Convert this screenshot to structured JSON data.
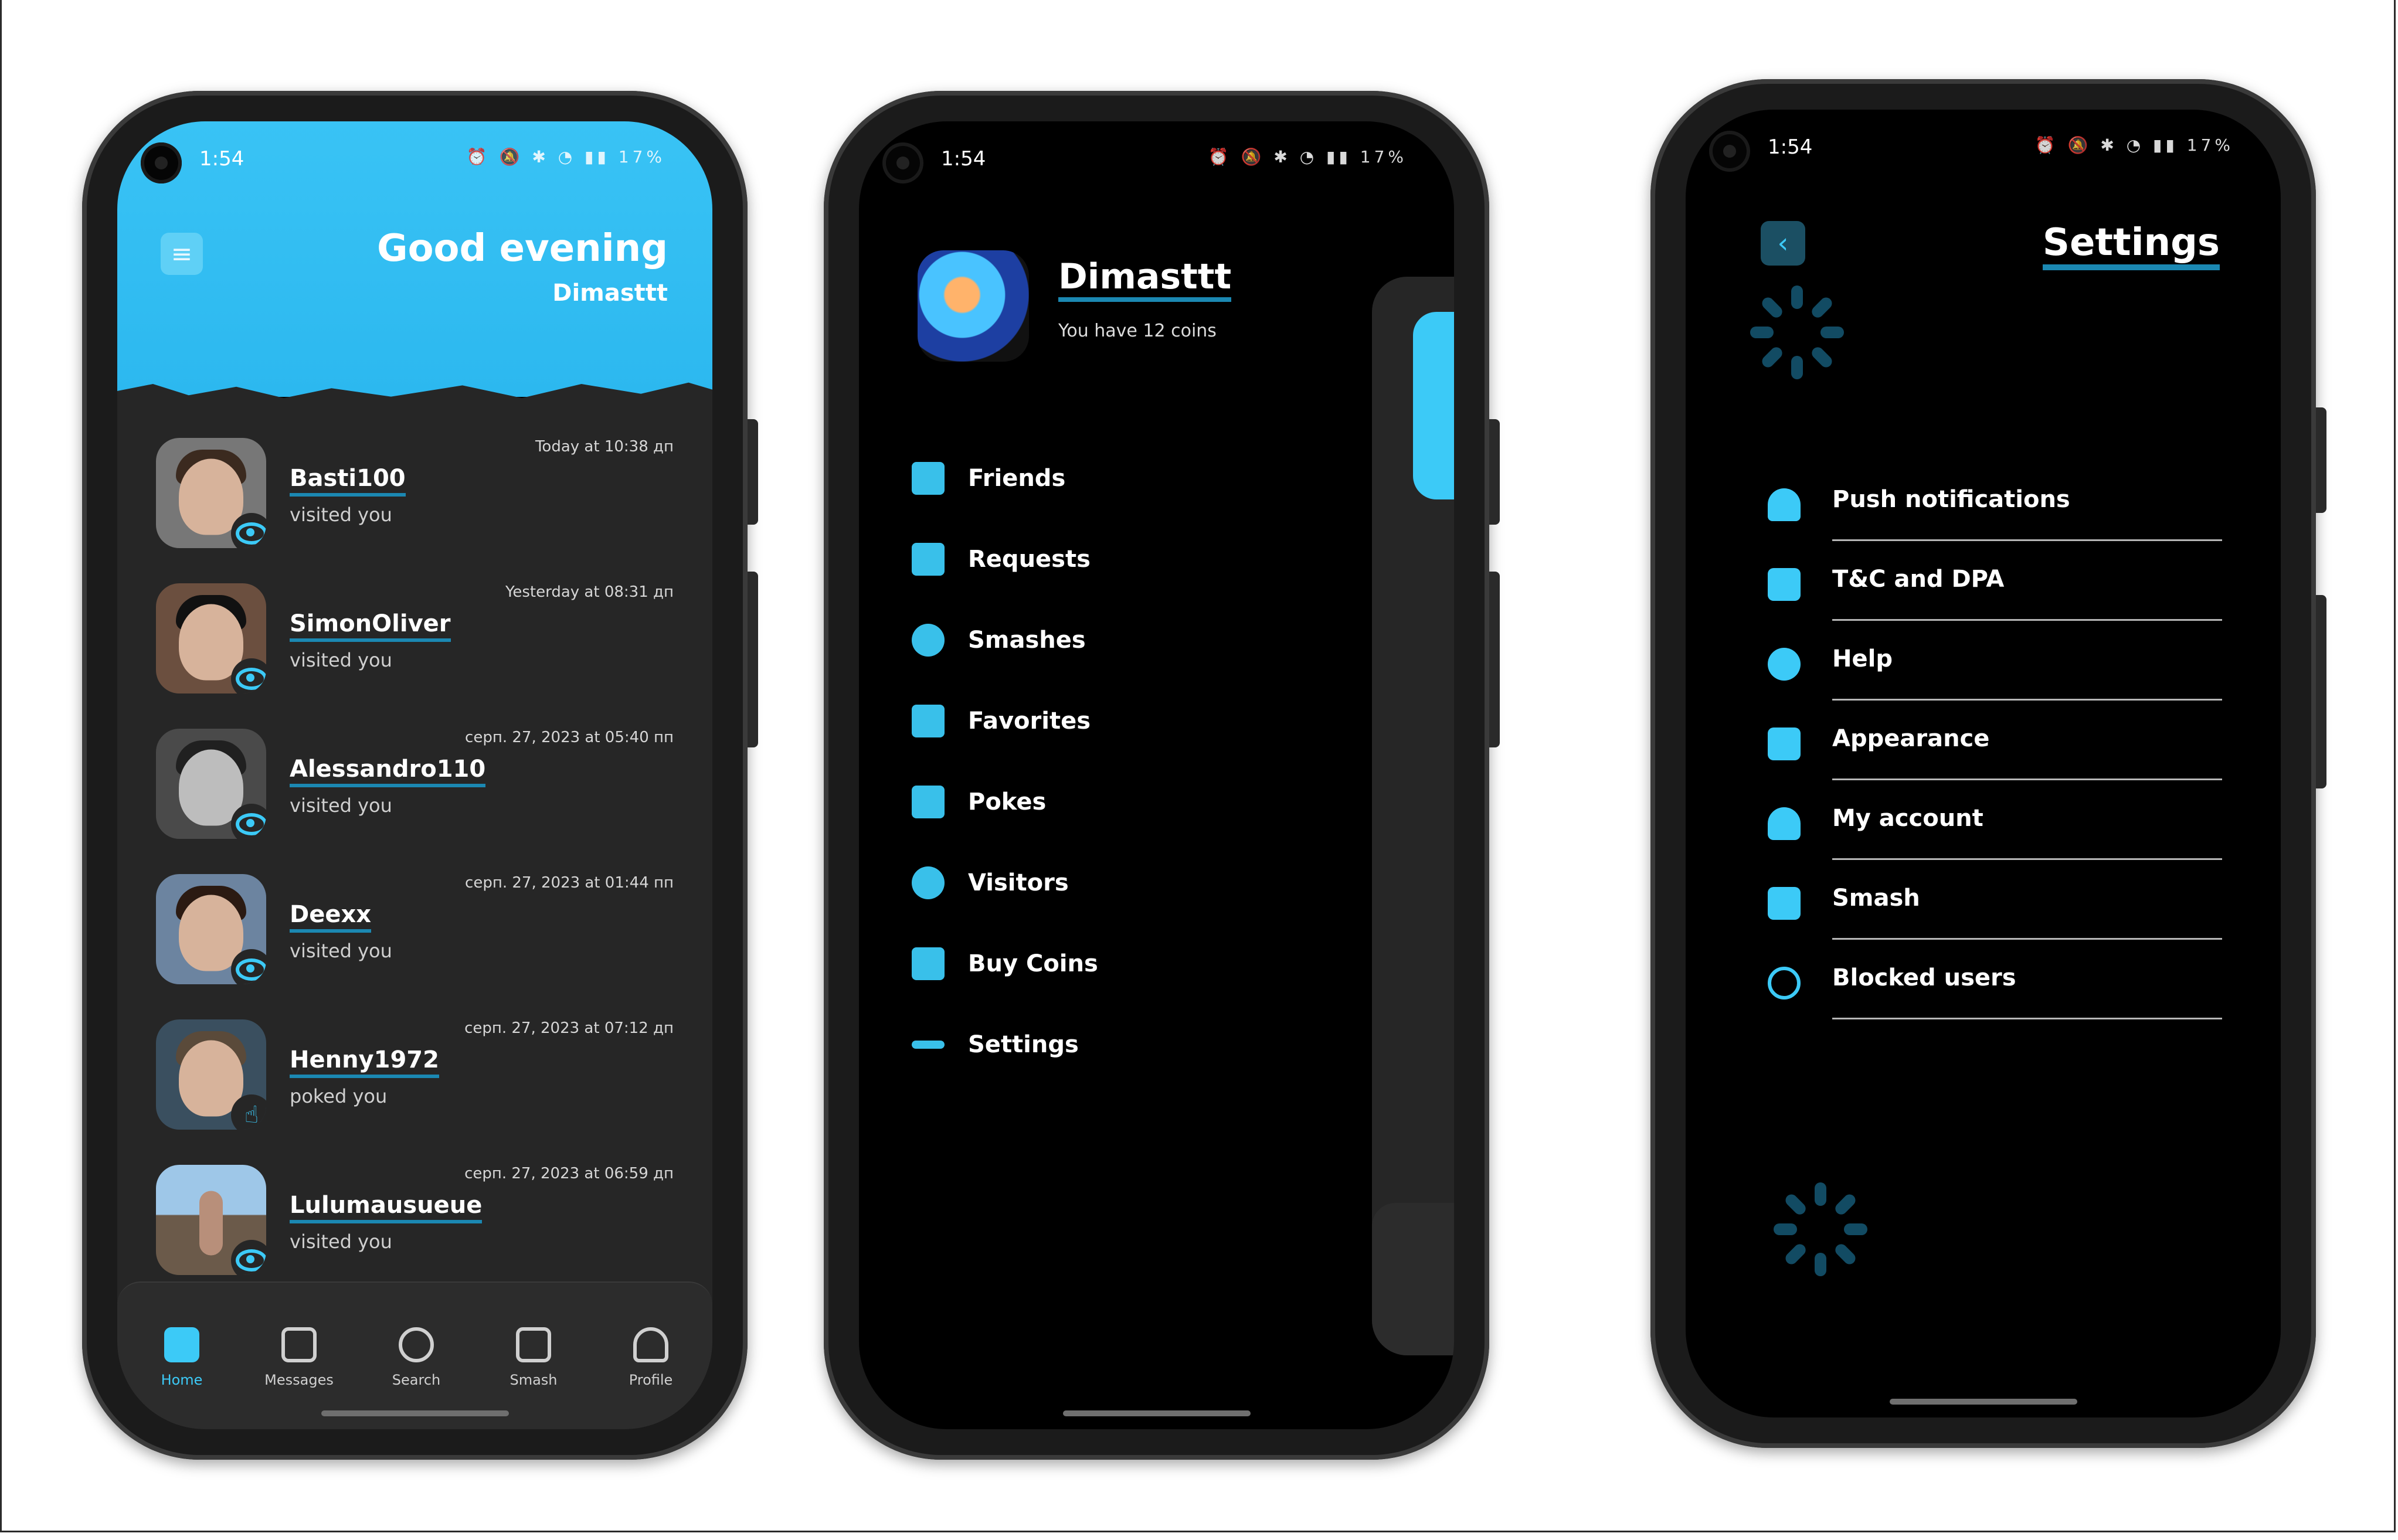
{
  "status": {
    "time": "1:54",
    "battery": "17%"
  },
  "phone1": {
    "greeting": "Good evening",
    "username": "Dimasttt",
    "items": [
      {
        "name": "Basti100",
        "action": "visited you",
        "time": "Today at 10:38 дп"
      },
      {
        "name": "SimonOliver",
        "action": "visited you",
        "time": "Yesterday at 08:31 дп"
      },
      {
        "name": "Alessandro110",
        "action": "visited you",
        "time": "серп. 27, 2023 at 05:40 пп"
      },
      {
        "name": "Deexx",
        "action": "visited you",
        "time": "серп. 27, 2023 at 01:44 пп"
      },
      {
        "name": "Henny1972",
        "action": "poked you",
        "time": "серп. 27, 2023 at 07:12 дп"
      },
      {
        "name": "Lulumausueue",
        "action": "visited you",
        "time": "серп. 27, 2023 at 06:59 дп"
      }
    ],
    "nav": [
      "Home",
      "Messages",
      "Search",
      "Smash",
      "Profile"
    ]
  },
  "phone2": {
    "name": "Dimasttt",
    "coins_text": "You have 12 coins",
    "menu": [
      "Friends",
      "Requests",
      "Smashes",
      "Favorites",
      "Pokes",
      "Visitors",
      "Buy Coins",
      "Settings"
    ]
  },
  "phone3": {
    "title": "Settings",
    "rows": [
      "Push notifications",
      "T&C and DPA",
      "Help",
      "Appearance",
      "My account",
      "Smash",
      "Blocked users"
    ]
  },
  "colors": {
    "accent": "#3ccaf7",
    "underline": "#1b88b2"
  },
  "icons": {
    "nav": [
      "home-icon",
      "messages-icon",
      "search-icon",
      "smash-icon",
      "profile-icon"
    ],
    "menu": [
      "friends-icon",
      "requests-icon",
      "heart-icon",
      "star-icon",
      "poke-icon",
      "eye-icon",
      "cart-icon",
      "dots-icon"
    ],
    "settings": [
      "bell-icon",
      "document-icon",
      "help-icon",
      "image-icon",
      "user-icon",
      "smash-icon",
      "block-icon"
    ]
  }
}
